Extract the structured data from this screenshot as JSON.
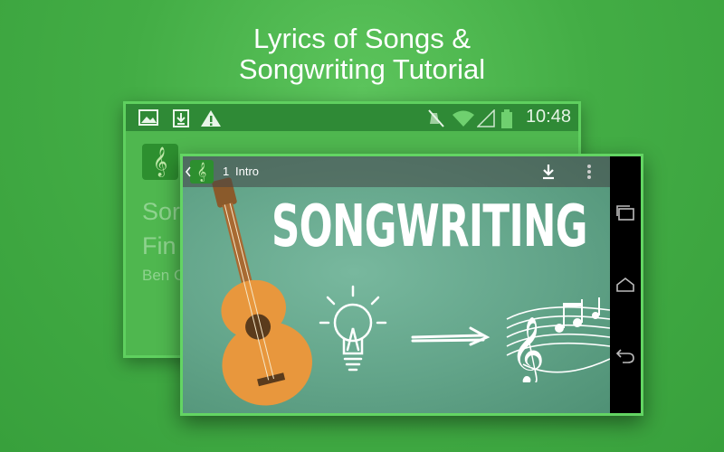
{
  "headline": {
    "line1": "Lyrics of Songs &",
    "line2": "Songwriting Tutorial"
  },
  "status_bar": {
    "time": "10:48",
    "icons": [
      "image-icon",
      "download-notification-icon",
      "warning-icon",
      "mute-icon",
      "wifi-icon",
      "signal-icon",
      "battery-icon"
    ]
  },
  "back_screen": {
    "app_icon_label": "udemy",
    "course_title_line1": "Sor",
    "course_title_line2": "Fin",
    "author": "Ben C"
  },
  "video_player": {
    "lecture_number": "1",
    "lecture_title": "Intro",
    "app_icon_label": "udemy",
    "slide_title": "SONGWRITING",
    "icons": [
      "back-arrow-icon",
      "download-icon",
      "overflow-menu-icon"
    ]
  },
  "nav_bar": {
    "icons": [
      "recent-apps-icon",
      "home-icon",
      "back-icon"
    ]
  },
  "colors": {
    "background": "#43ad45",
    "accent_border": "#63d563",
    "status_bar": "#2f8a36",
    "slide_background": "#62a489",
    "guitar": "#e8973d"
  }
}
